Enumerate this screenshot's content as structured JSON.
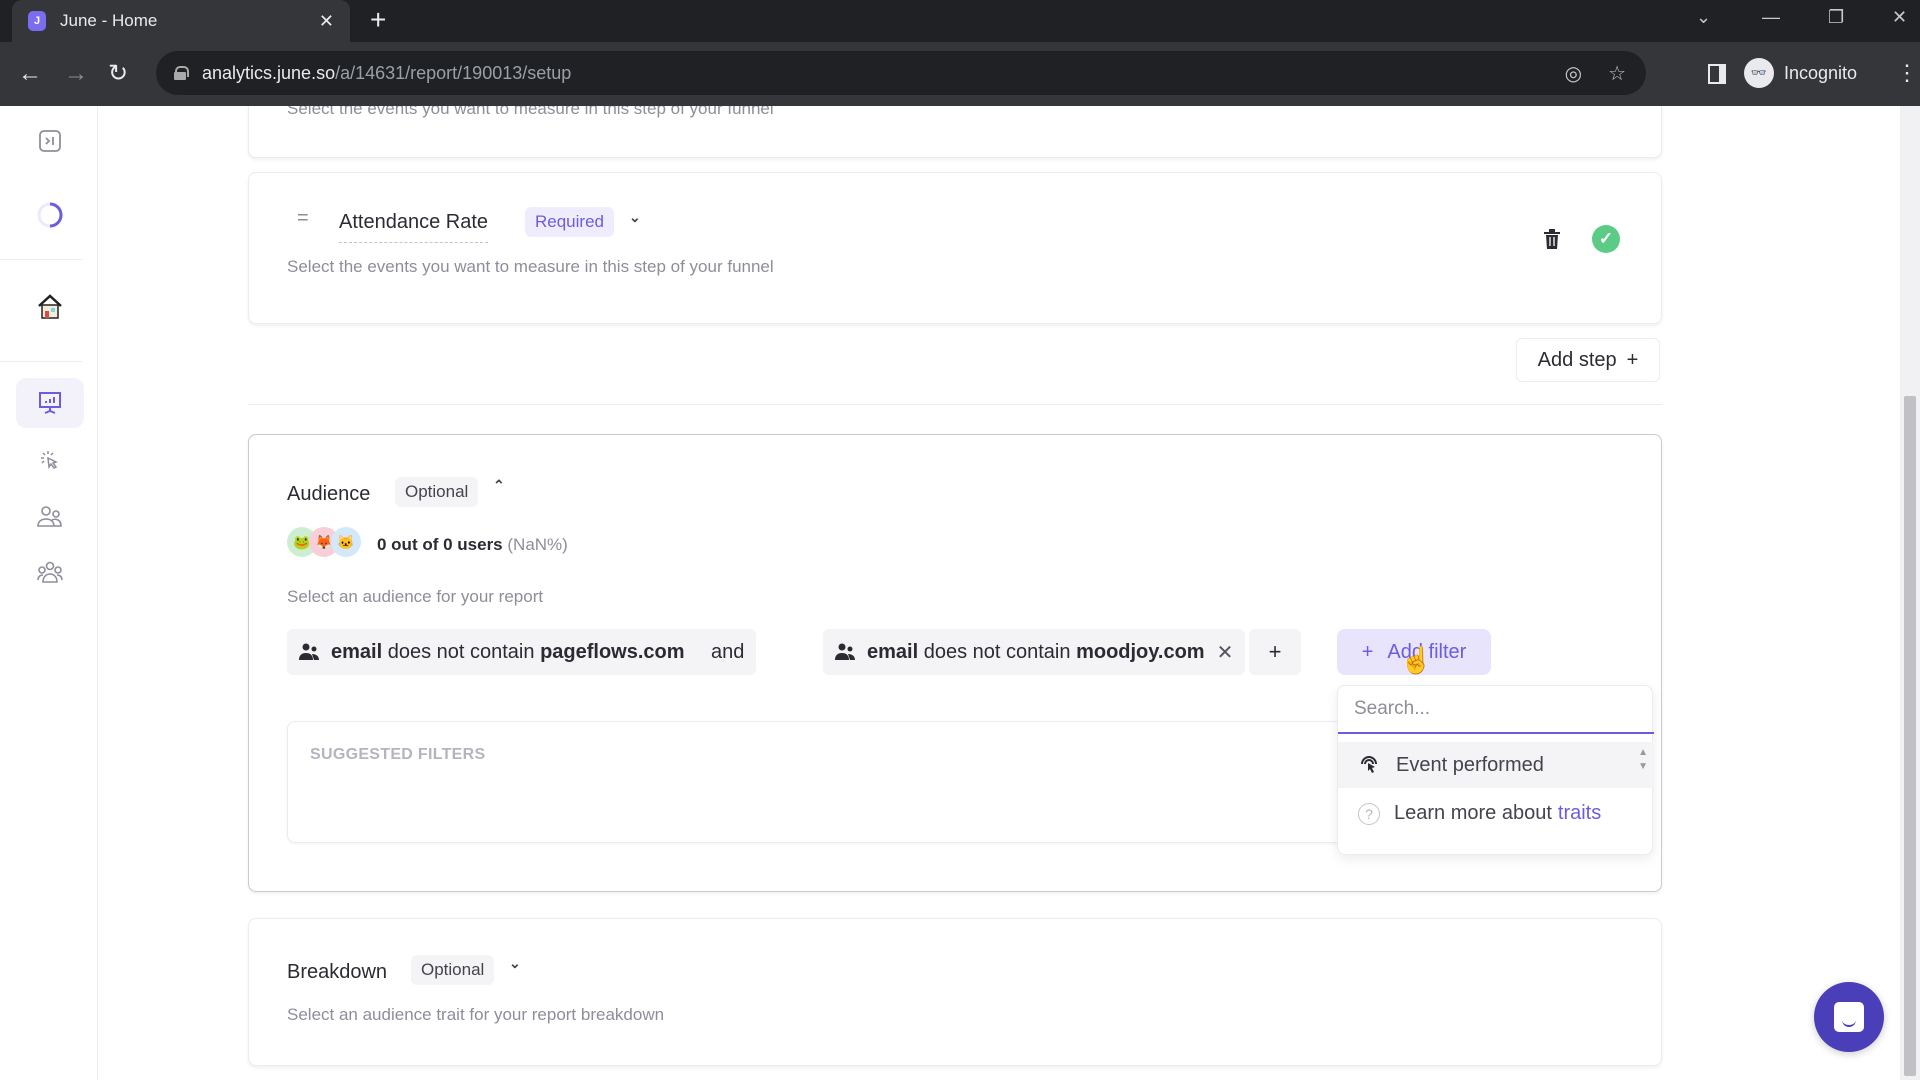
{
  "browser": {
    "tab_title": "June - Home",
    "url_host": "analytics.june.so",
    "url_path": "/a/14631/report/190013/setup",
    "profile_label": "Incognito"
  },
  "sidebar": {
    "items": [
      {
        "name": "collapse-sidebar",
        "icon": "collapse-icon"
      },
      {
        "name": "onboarding-progress",
        "icon": "progress-ring-icon"
      },
      {
        "name": "home",
        "icon": "house-icon"
      },
      {
        "name": "reports",
        "icon": "presentation-chart-icon",
        "active": true
      },
      {
        "name": "events",
        "icon": "cursor-click-icon"
      },
      {
        "name": "people",
        "icon": "people-icon"
      },
      {
        "name": "companies",
        "icon": "group-icon"
      }
    ]
  },
  "steps": {
    "previous_step_description": "Select the events you want to measure in this step of your funnel",
    "current_step": {
      "handle": "=",
      "name": "Attendance Rate",
      "badge": "Required",
      "description": "Select the events you want to measure in this step of your funnel",
      "status_color": "#5ccb86"
    },
    "add_step_label": "Add step",
    "add_step_icon": "+"
  },
  "audience": {
    "title": "Audience",
    "badge": "Optional",
    "users_count": "0 out of 0 users",
    "users_pct": "(NaN%)",
    "description": "Select an audience for your report",
    "filters": [
      {
        "field": "email",
        "operator": "does not contain",
        "value": "pageflows.com"
      },
      {
        "field": "email",
        "operator": "does not contain",
        "value": "moodjoy.com"
      }
    ],
    "conjunction": "and",
    "add_group_label": "+",
    "add_filter_label": "Add filter",
    "add_filter_icon": "+",
    "suggested_title": "SUGGESTED FILTERS",
    "accent_color": "#6b5ce0"
  },
  "filter_dropdown": {
    "search_placeholder": "Search...",
    "search_value": "",
    "options": [
      {
        "label": "Event performed",
        "icon": "cursor-click-icon"
      }
    ],
    "learn_more_prefix": "Learn more about",
    "learn_more_link": "traits"
  },
  "breakdown": {
    "title": "Breakdown",
    "badge": "Optional",
    "description": "Select an audience trait for your report breakdown"
  }
}
